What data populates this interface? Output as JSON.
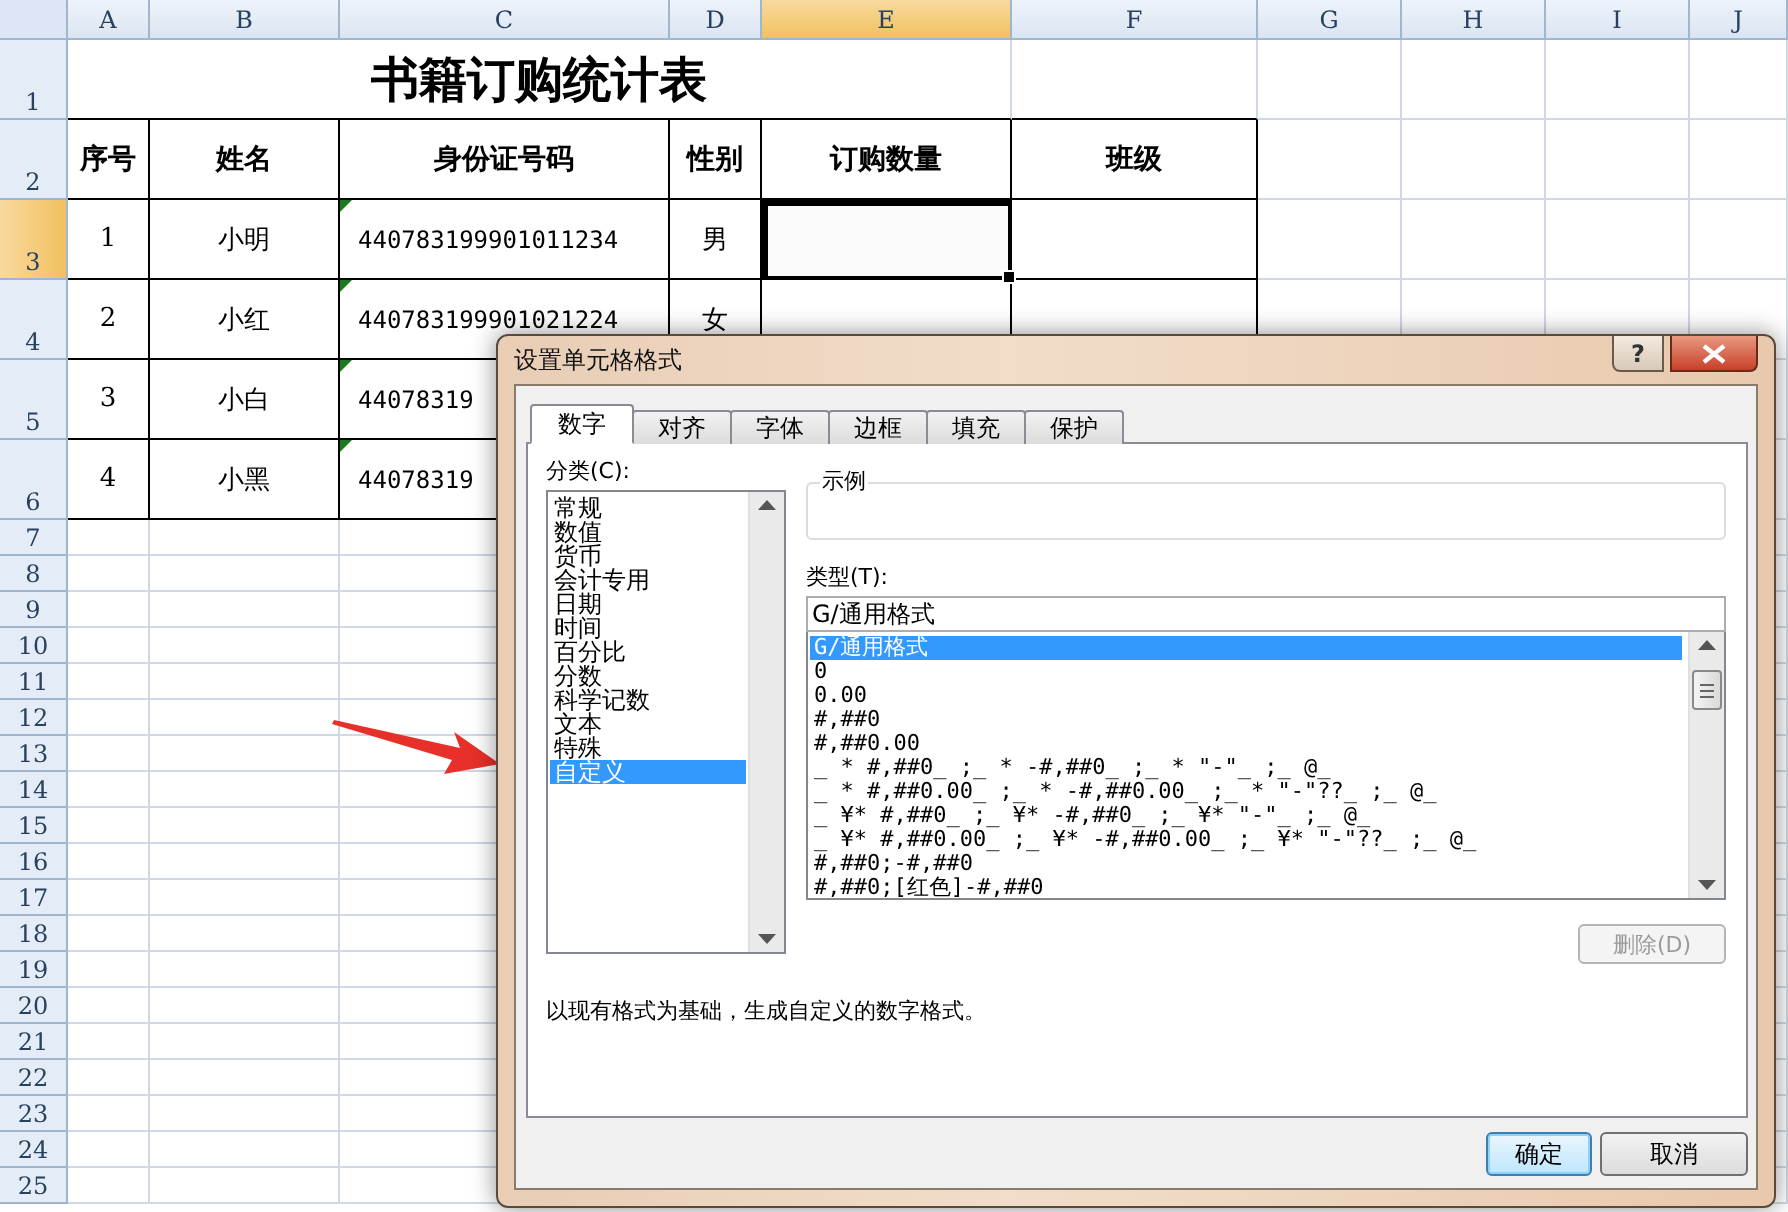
{
  "sheet": {
    "columns": [
      {
        "label": "A",
        "selected": false
      },
      {
        "label": "B",
        "selected": false
      },
      {
        "label": "C",
        "selected": false
      },
      {
        "label": "D",
        "selected": false
      },
      {
        "label": "E",
        "selected": true
      },
      {
        "label": "F",
        "selected": false
      },
      {
        "label": "G",
        "selected": false
      },
      {
        "label": "H",
        "selected": false
      },
      {
        "label": "I",
        "selected": false
      },
      {
        "label": "J",
        "selected": false
      }
    ],
    "row_headers": [
      {
        "label": "1",
        "selected": false
      },
      {
        "label": "2",
        "selected": false
      },
      {
        "label": "3",
        "selected": true
      },
      {
        "label": "4",
        "selected": false
      },
      {
        "label": "5",
        "selected": false
      },
      {
        "label": "6",
        "selected": false
      },
      {
        "label": "7",
        "selected": false
      },
      {
        "label": "8",
        "selected": false
      },
      {
        "label": "9",
        "selected": false
      },
      {
        "label": "10",
        "selected": false
      },
      {
        "label": "11",
        "selected": false
      },
      {
        "label": "12",
        "selected": false
      },
      {
        "label": "13",
        "selected": false
      },
      {
        "label": "14",
        "selected": false
      },
      {
        "label": "15",
        "selected": false
      },
      {
        "label": "16",
        "selected": false
      },
      {
        "label": "17",
        "selected": false
      },
      {
        "label": "18",
        "selected": false
      },
      {
        "label": "19",
        "selected": false
      },
      {
        "label": "20",
        "selected": false
      },
      {
        "label": "21",
        "selected": false
      },
      {
        "label": "22",
        "selected": false
      },
      {
        "label": "23",
        "selected": false
      },
      {
        "label": "24",
        "selected": false
      },
      {
        "label": "25",
        "selected": false
      }
    ],
    "title": "书籍订购统计表",
    "table_headers": [
      "序号",
      "姓名",
      "身份证号码",
      "性别",
      "订购数量",
      "班级"
    ],
    "records": [
      {
        "cells": [
          {
            "text": "1",
            "selected": false
          },
          {
            "text": "小明",
            "selected": false
          },
          {
            "text": "440783199901011234",
            "selected": false
          },
          {
            "text": "男",
            "selected": false
          },
          {
            "selected": true
          },
          {
            "selected": false
          }
        ],
        "flagged": true
      },
      {
        "cells": [
          {
            "text": "2",
            "selected": false
          },
          {
            "text": "小红",
            "selected": false
          },
          {
            "text": "440783199901021224",
            "selected": false
          },
          {
            "text": "女",
            "selected": false
          },
          {
            "selected": false
          },
          {
            "selected": false
          }
        ],
        "flagged": true
      },
      {
        "cells": [
          {
            "text": "3",
            "selected": false
          },
          {
            "text": "小白",
            "selected": false
          },
          {
            "text": "44078319",
            "selected": false
          }
        ],
        "flagged": true
      },
      {
        "cells": [
          {
            "text": "4",
            "selected": false
          },
          {
            "text": "小黑",
            "selected": false
          },
          {
            "text": "44078319",
            "selected": false
          }
        ],
        "flagged": true
      }
    ]
  },
  "dialog": {
    "title": "设置单元格格式",
    "help_button": "?",
    "tabs": [
      {
        "label": "数字",
        "selected": true
      },
      {
        "label": "对齐",
        "selected": false
      },
      {
        "label": "字体",
        "selected": false
      },
      {
        "label": "边框",
        "selected": false
      },
      {
        "label": "填充",
        "selected": false
      },
      {
        "label": "保护",
        "selected": false
      }
    ],
    "category_label": "分类(C):",
    "categories": [
      {
        "label": "常规",
        "selected": false
      },
      {
        "label": "数值",
        "selected": false
      },
      {
        "label": "货币",
        "selected": false
      },
      {
        "label": "会计专用",
        "selected": false
      },
      {
        "label": "日期",
        "selected": false
      },
      {
        "label": "时间",
        "selected": false
      },
      {
        "label": "百分比",
        "selected": false
      },
      {
        "label": "分数",
        "selected": false
      },
      {
        "label": "科学记数",
        "selected": false
      },
      {
        "label": "文本",
        "selected": false
      },
      {
        "label": "特殊",
        "selected": false
      },
      {
        "label": "自定义",
        "selected": true
      }
    ],
    "sample_label": "示例",
    "type_label": "类型(T):",
    "type_value": "G/通用格式",
    "formats": [
      {
        "label": "G/通用格式",
        "selected": true
      },
      {
        "label": "0",
        "selected": false
      },
      {
        "label": "0.00",
        "selected": false
      },
      {
        "label": "#,##0",
        "selected": false
      },
      {
        "label": "#,##0.00",
        "selected": false
      },
      {
        "label": "_ * #,##0_ ;_ * -#,##0_ ;_ * \"-\"_ ;_ @_",
        "selected": false
      },
      {
        "label": "_ * #,##0.00_ ;_ * -#,##0.00_ ;_ * \"-\"??_ ;_ @_",
        "selected": false
      },
      {
        "label": "_ ¥* #,##0_ ;_ ¥* -#,##0_ ;_ ¥* \"-\"_ ;_ @_",
        "selected": false
      },
      {
        "label": "_ ¥* #,##0.00_ ;_ ¥* -#,##0.00_ ;_ ¥* \"-\"??_ ;_ @_",
        "selected": false
      },
      {
        "label": "#,##0;-#,##0",
        "selected": false
      },
      {
        "label": "#,##0;[红色]-#,##0",
        "selected": false
      }
    ],
    "delete_button": {
      "label": "删除(D)",
      "disabled": true
    },
    "description": "以现有格式为基础，生成自定义的数字格式。",
    "buttons": [
      {
        "label": "确定",
        "default": true
      },
      {
        "label": "取消",
        "default": false
      }
    ]
  }
}
